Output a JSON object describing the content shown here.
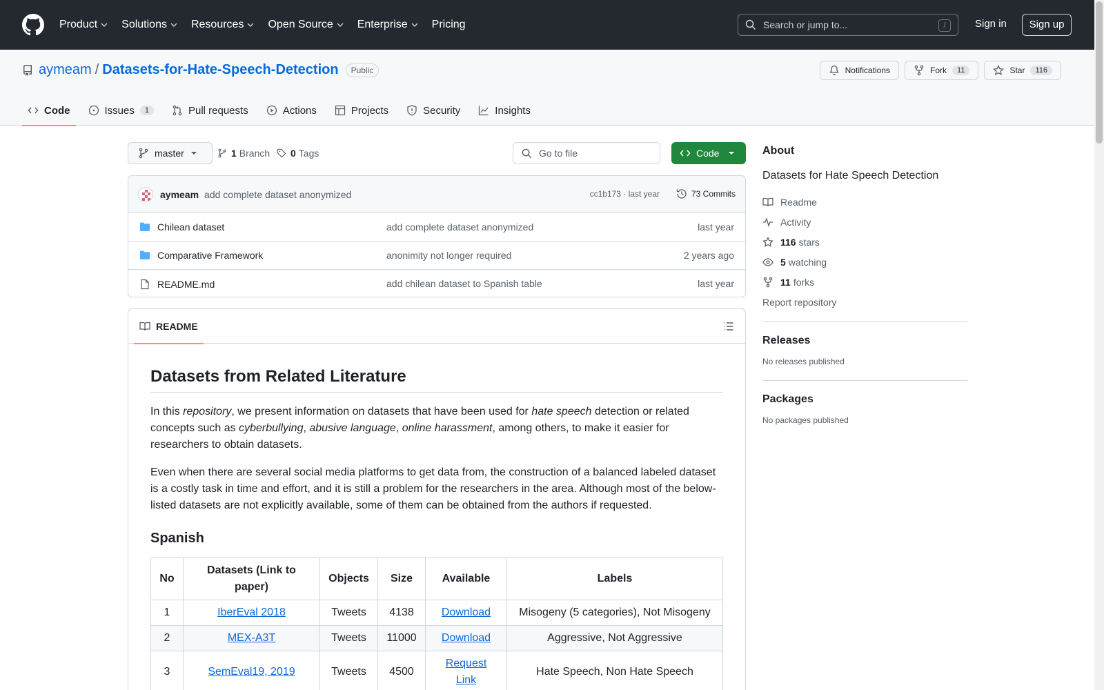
{
  "header": {
    "nav": [
      "Product",
      "Solutions",
      "Resources",
      "Open Source",
      "Enterprise",
      "Pricing"
    ],
    "search_placeholder": "Search or jump to...",
    "search_shortcut": "/",
    "signin": "Sign in",
    "signup": "Sign up"
  },
  "repo": {
    "owner": "aymeam",
    "separator": "/",
    "name": "Datasets-for-Hate-Speech-Detection",
    "visibility": "Public",
    "notifications_label": "Notifications",
    "fork_label": "Fork",
    "fork_count": "11",
    "star_label": "Star",
    "star_count": "116"
  },
  "tabs": {
    "code": "Code",
    "issues": "Issues",
    "issues_count": "1",
    "pulls": "Pull requests",
    "actions": "Actions",
    "projects": "Projects",
    "security": "Security",
    "insights": "Insights"
  },
  "filebar": {
    "branch": "master",
    "branch_count": "1",
    "branch_label": "Branch",
    "tag_count": "0",
    "tag_label": "Tags",
    "goto_placeholder": "Go to file",
    "code_button": "Code"
  },
  "commit": {
    "author": "aymeam",
    "message": "add complete dataset anonymized",
    "hash_time": "cc1b173 · last year",
    "commits": "73 Commits"
  },
  "files": [
    {
      "name": "Chilean dataset",
      "message": "add complete dataset anonymized",
      "date": "last year",
      "type": "folder"
    },
    {
      "name": "Comparative Framework",
      "message": "anonimity not longer required",
      "date": "2 years ago",
      "type": "folder"
    },
    {
      "name": "README.md",
      "message": "add chilean dataset to Spanish table",
      "date": "last year",
      "type": "file"
    }
  ],
  "readme": {
    "tab": "README",
    "title": "Datasets from Related Literature",
    "p1": {
      "a": "In this ",
      "b": "repository",
      "c": ", we present information on datasets that have been used for ",
      "d": "hate speech",
      "e": " detection or related concepts such as ",
      "f": "cyberbullying",
      "g": ", ",
      "h": "abusive language",
      "i": ", ",
      "j": "online harassment",
      "k": ", among others, to make it easier for researchers to obtain datasets."
    },
    "p2": "Even when there are several social media platforms to get data from, the construction of a balanced labeled dataset is a costly task in time and effort, and it is still a problem for the researchers in the area. Although most of the below-listed datasets are not explicitly available, some of them can be obtained from the authors if requested.",
    "section": "Spanish",
    "table": {
      "headers": [
        "No",
        "Datasets (Link to paper)",
        "Objects",
        "Size",
        "Available",
        "Labels"
      ],
      "rows": [
        [
          "1",
          "IberEval 2018",
          "Tweets",
          "4138",
          "Download",
          "Misogeny (5 categories), Not Misogeny"
        ],
        [
          "2",
          "MEX-A3T",
          "Tweets",
          "11000",
          "Download",
          "Aggressive, Not Aggressive"
        ],
        [
          "3",
          "SemEval19, 2019",
          "Tweets",
          "4500",
          "Request Link",
          "Hate Speech, Non Hate Speech"
        ]
      ]
    }
  },
  "sidebar": {
    "about": "About",
    "description": "Datasets for Hate Speech Detection",
    "readme": "Readme",
    "activity": "Activity",
    "stars_count": "116",
    "stars_label": "stars",
    "watching_count": "5",
    "watching_label": "watching",
    "forks_count": "11",
    "forks_label": "forks",
    "report": "Report repository",
    "releases": "Releases",
    "no_releases": "No releases published",
    "packages": "Packages",
    "no_packages": "No packages published"
  },
  "colors": {
    "header_bg": "#24292f",
    "link": "#0969da",
    "green_button": "#1f883d",
    "active_tab": "#fd8c73"
  }
}
